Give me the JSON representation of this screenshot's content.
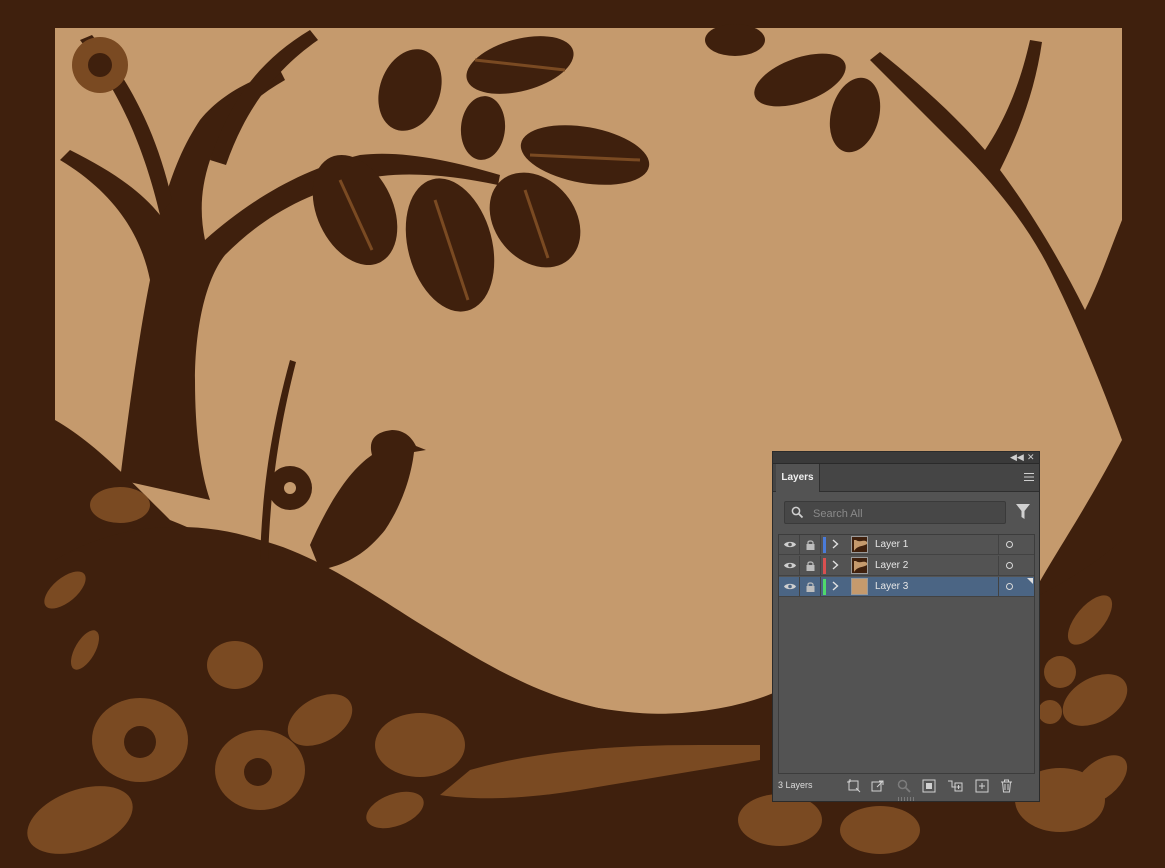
{
  "colors": {
    "background": "#3f200d",
    "sky": "#c59a6d",
    "foliage_light": "#7a4a22",
    "panel": "#535353",
    "selected_row": "#4b6584"
  },
  "panel": {
    "tab_label": "Layers",
    "search_placeholder": "Search All",
    "layers": [
      {
        "name": "Layer 1",
        "color": "#4a7bd9",
        "visible": true,
        "selected": false
      },
      {
        "name": "Layer 2",
        "color": "#d95050",
        "visible": true,
        "selected": false
      },
      {
        "name": "Layer 3",
        "color": "#4fd96a",
        "visible": true,
        "selected": true
      }
    ],
    "footer_count": "3 Layers"
  },
  "icons": {
    "collapse": "double-chevron-left-icon",
    "close": "close-icon",
    "panel_menu": "hamburger-menu-icon",
    "search": "search-icon",
    "filter": "filter-icon",
    "footer": [
      "collect-for-export-icon",
      "export-icon",
      "locate-object-icon",
      "make-clipping-mask-icon",
      "create-sublayer-icon",
      "new-layer-icon",
      "trash-icon"
    ]
  }
}
